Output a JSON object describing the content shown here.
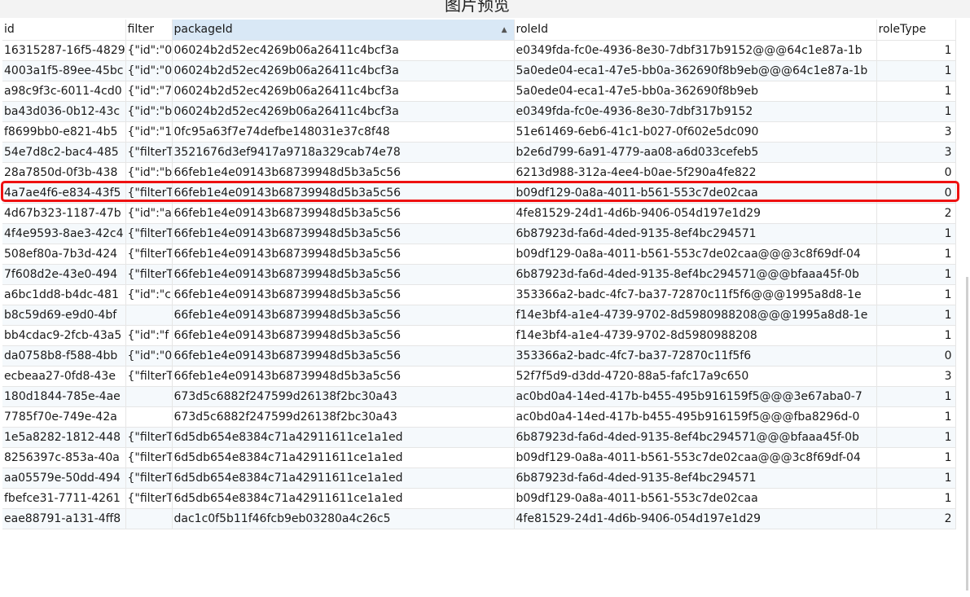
{
  "window": {
    "title": "图片预览"
  },
  "columns": [
    "id",
    "filter",
    "packageId",
    "roleId",
    "roleType"
  ],
  "rows": [
    [
      "16315287-16f5-4829",
      "{\"id\":\"0",
      "06024b2d52ec4269b06a26411c4bcf3a",
      "e0349fda-fc0e-4936-8e30-7dbf317b9152@@@64c1e87a-1b",
      "1"
    ],
    [
      "4003a1f5-89ee-45bc",
      "{\"id\":\"0",
      "06024b2d52ec4269b06a26411c4bcf3a",
      "5a0ede04-eca1-47e5-bb0a-362690f8b9eb@@@64c1e87a-1b",
      "1"
    ],
    [
      "a98c9f3c-6011-4cd0",
      "{\"id\":\"7",
      "06024b2d52ec4269b06a26411c4bcf3a",
      "5a0ede04-eca1-47e5-bb0a-362690f8b9eb",
      "1"
    ],
    [
      "ba43d036-0b12-43c",
      "{\"id\":\"b",
      "06024b2d52ec4269b06a26411c4bcf3a",
      "e0349fda-fc0e-4936-8e30-7dbf317b9152",
      "1"
    ],
    [
      "f8699bb0-e821-4b5",
      "{\"id\":\"1",
      "0fc95a63f7e74defbe148031e37c8f48",
      "51e61469-6eb6-41c1-b027-0f602e5dc090",
      "3"
    ],
    [
      "54e7d8c2-bac4-485",
      "{\"filterT",
      "3521676d3ef9417a9718a329cab74e78",
      "b2e6d799-6a91-4779-aa08-a6d033cefeb5",
      "3"
    ],
    [
      "28a7850d-0f3b-438",
      "{\"id\":\"b",
      "66feb1e4e09143b68739948d5b3a5c56",
      "6213d988-312a-4ee4-b0ae-5f290a4fe822",
      "0"
    ],
    [
      "4a7ae4f6-e834-43f5",
      "{\"filterT",
      "66feb1e4e09143b68739948d5b3a5c56",
      "b09df129-0a8a-4011-b561-553c7de02caa",
      "0"
    ],
    [
      "4d67b323-1187-47b",
      "{\"id\":\"a",
      "66feb1e4e09143b68739948d5b3a5c56",
      "4fe81529-24d1-4d6b-9406-054d197e1d29",
      "2"
    ],
    [
      "4f4e9593-8ae3-42c4",
      "{\"filterT",
      "66feb1e4e09143b68739948d5b3a5c56",
      "6b87923d-fa6d-4ded-9135-8ef4bc294571",
      "1"
    ],
    [
      "508ef80a-7b3d-424",
      "{\"filterT",
      "66feb1e4e09143b68739948d5b3a5c56",
      "b09df129-0a8a-4011-b561-553c7de02caa@@@3c8f69df-04",
      "1"
    ],
    [
      "7f608d2e-43e0-494",
      "{\"filterT",
      "66feb1e4e09143b68739948d5b3a5c56",
      "6b87923d-fa6d-4ded-9135-8ef4bc294571@@@bfaaa45f-0b",
      "1"
    ],
    [
      "a6bc1dd8-b4dc-481",
      "{\"id\":\"c",
      "66feb1e4e09143b68739948d5b3a5c56",
      "353366a2-badc-4fc7-ba37-72870c11f5f6@@@1995a8d8-1e",
      "1"
    ],
    [
      "b8c59d69-e9d0-4bf",
      "",
      "66feb1e4e09143b68739948d5b3a5c56",
      "f14e3bf4-a1e4-4739-9702-8d5980988208@@@1995a8d8-1e",
      "1"
    ],
    [
      "bb4cdac9-2fcb-43a5",
      "{\"id\":\"f",
      "66feb1e4e09143b68739948d5b3a5c56",
      "f14e3bf4-a1e4-4739-9702-8d5980988208",
      "1"
    ],
    [
      "da0758b8-f588-4bb",
      "{\"id\":\"0",
      "66feb1e4e09143b68739948d5b3a5c56",
      "353366a2-badc-4fc7-ba37-72870c11f5f6",
      "0"
    ],
    [
      "ecbeaa27-0fd8-43e",
      "{\"filterT",
      "66feb1e4e09143b68739948d5b3a5c56",
      "52f7f5d9-d3dd-4720-88a5-fafc17a9c650",
      "3"
    ],
    [
      "180d1844-785e-4ae",
      "",
      "673d5c6882f247599d26138f2bc30a43",
      "ac0bd0a4-14ed-417b-b455-495b916159f5@@@3e67aba0-7",
      "1"
    ],
    [
      "7785f70e-749e-42a",
      "",
      "673d5c6882f247599d26138f2bc30a43",
      "ac0bd0a4-14ed-417b-b455-495b916159f5@@@fba8296d-0",
      "1"
    ],
    [
      "1e5a8282-1812-448",
      "{\"filterT",
      "6d5db654e8384c71a42911611ce1a1ed",
      "6b87923d-fa6d-4ded-9135-8ef4bc294571@@@bfaaa45f-0b",
      "1"
    ],
    [
      "8256397c-853a-40a",
      "{\"filterT",
      "6d5db654e8384c71a42911611ce1a1ed",
      "b09df129-0a8a-4011-b561-553c7de02caa@@@3c8f69df-04",
      "1"
    ],
    [
      "aa05579e-50dd-494",
      "{\"filterT",
      "6d5db654e8384c71a42911611ce1a1ed",
      "6b87923d-fa6d-4ded-9135-8ef4bc294571",
      "1"
    ],
    [
      "fbefce31-7711-4261",
      "{\"filterT",
      "6d5db654e8384c71a42911611ce1a1ed",
      "b09df129-0a8a-4011-b561-553c7de02caa",
      "1"
    ],
    [
      "eae88791-a131-4ff8",
      "",
      "dac1c0f5b11f46fcb9eb03280a4c26c5",
      "4fe81529-24d1-4d6b-9406-054d197e1d29",
      "2"
    ]
  ],
  "colors": {
    "highlight": "#ee1111",
    "sorted_header": "#d9e8f6",
    "alt_row": "#f5f9fc"
  }
}
